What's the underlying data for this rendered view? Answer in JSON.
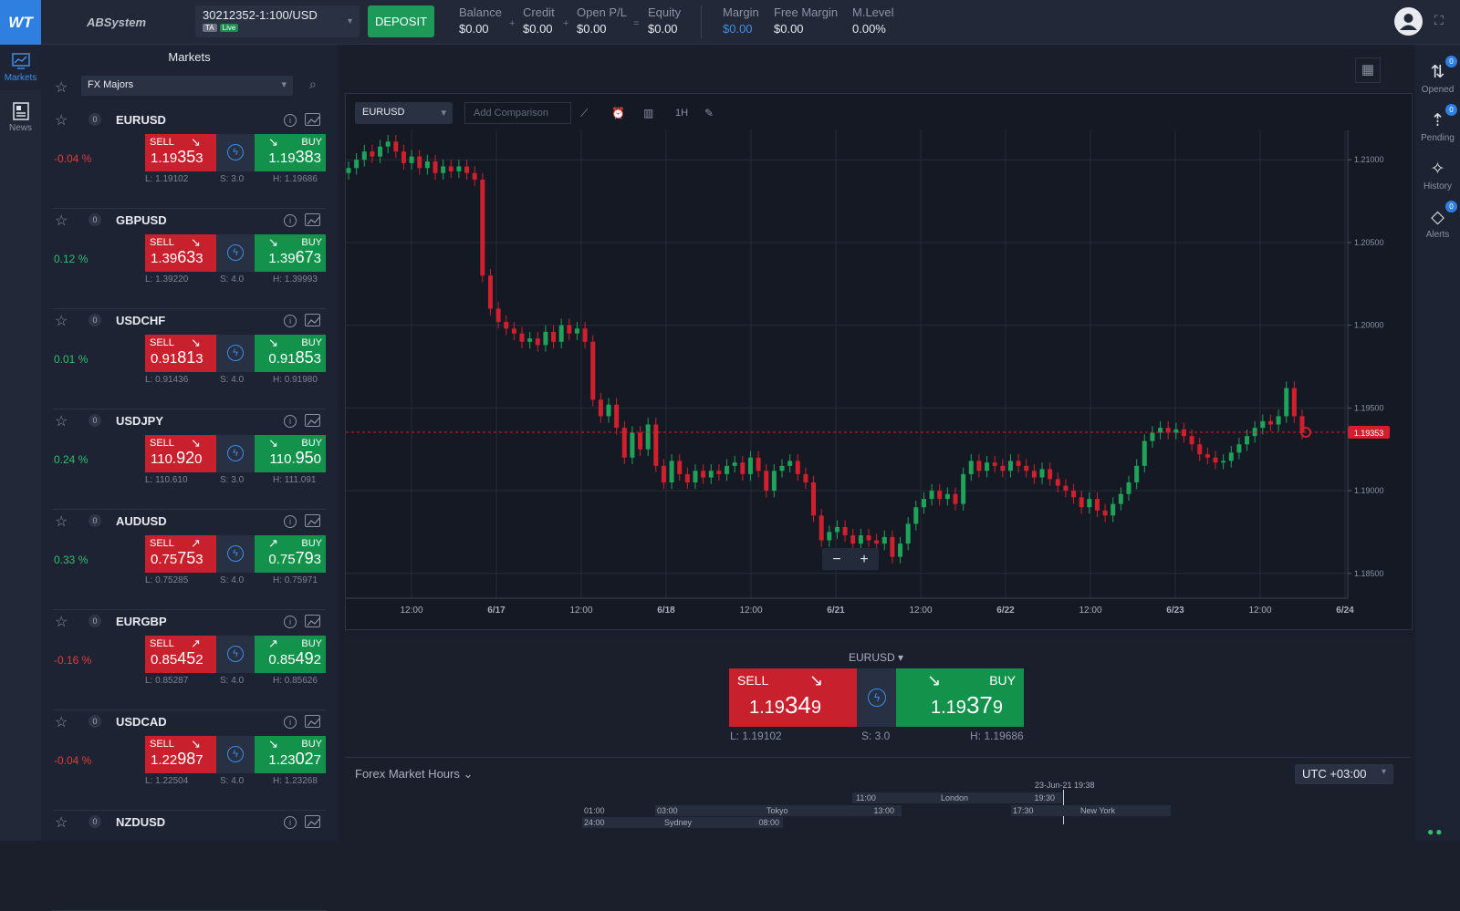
{
  "topbar": {
    "logo": "WT",
    "brand": "ABSystem",
    "account": {
      "number": "30212352-1:100/USD",
      "tag_ta": "TA",
      "tag_live": "Live"
    },
    "deposit_label": "DEPOSIT",
    "stats": [
      {
        "label": "Balance",
        "value": "$0.00"
      },
      {
        "label": "Credit",
        "value": "$0.00"
      },
      {
        "label": "Open P/L",
        "value": "$0.00"
      },
      {
        "label": "Equity",
        "value": "$0.00"
      },
      {
        "label": "Margin",
        "value": "$0.00"
      },
      {
        "label": "Free Margin",
        "value": "$0.00"
      },
      {
        "label": "M.Level",
        "value": "0.00%"
      }
    ],
    "ops": [
      "+",
      "+",
      "="
    ],
    "margin_color": "#3d8fe8"
  },
  "leftnav": {
    "items": [
      {
        "label": "Markets",
        "icon": "chart-monitor-icon"
      },
      {
        "label": "News",
        "icon": "newspaper-icon"
      }
    ]
  },
  "markets": {
    "title": "Markets",
    "filter": "FX Majors",
    "symbols": [
      {
        "name": "EURUSD",
        "count": "0",
        "change": "-0.04 %",
        "dir": "neg",
        "sell": {
          "big": "1.19",
          "pip": "35",
          "small": "3"
        },
        "buy": {
          "big": "1.19",
          "pip": "38",
          "small": "3"
        },
        "low": "L: 1.19102",
        "spread": "S: 3.0",
        "high": "H: 1.19686",
        "arrow": "↘"
      },
      {
        "name": "GBPUSD",
        "count": "0",
        "change": "0.12 %",
        "dir": "pos",
        "sell": {
          "big": "1.39",
          "pip": "63",
          "small": "3"
        },
        "buy": {
          "big": "1.39",
          "pip": "67",
          "small": "3"
        },
        "low": "L: 1.39220",
        "spread": "S: 4.0",
        "high": "H: 1.39993",
        "arrow": "↘"
      },
      {
        "name": "USDCHF",
        "count": "0",
        "change": "0.01 %",
        "dir": "pos",
        "sell": {
          "big": "0.91",
          "pip": "81",
          "small": "3"
        },
        "buy": {
          "big": "0.91",
          "pip": "85",
          "small": "3"
        },
        "low": "L: 0.91436",
        "spread": "S: 4.0",
        "high": "H: 0.91980",
        "arrow": "↘"
      },
      {
        "name": "USDJPY",
        "count": "0",
        "change": "0.24 %",
        "dir": "pos",
        "sell": {
          "big": "110.",
          "pip": "92",
          "small": "0"
        },
        "buy": {
          "big": "110.",
          "pip": "95",
          "small": "0"
        },
        "low": "L: 110.610",
        "spread": "S: 3.0",
        "high": "H: 111.091",
        "arrow": "↘"
      },
      {
        "name": "AUDUSD",
        "count": "0",
        "change": "0.33 %",
        "dir": "pos",
        "sell": {
          "big": "0.75",
          "pip": "75",
          "small": "3"
        },
        "buy": {
          "big": "0.75",
          "pip": "79",
          "small": "3"
        },
        "low": "L: 0.75285",
        "spread": "S: 4.0",
        "high": "H: 0.75971",
        "arrow": "↗"
      },
      {
        "name": "EURGBP",
        "count": "0",
        "change": "-0.16 %",
        "dir": "neg",
        "sell": {
          "big": "0.85",
          "pip": "45",
          "small": "2"
        },
        "buy": {
          "big": "0.85",
          "pip": "49",
          "small": "2"
        },
        "low": "L: 0.85287",
        "spread": "S: 4.0",
        "high": "H: 0.85626",
        "arrow": "↗"
      },
      {
        "name": "USDCAD",
        "count": "0",
        "change": "-0.04 %",
        "dir": "neg",
        "sell": {
          "big": "1.22",
          "pip": "98",
          "small": "7"
        },
        "buy": {
          "big": "1.23",
          "pip": "02",
          "small": "7"
        },
        "low": "L: 1.22504",
        "spread": "S: 4.0",
        "high": "H: 1.23268",
        "arrow": "↘"
      },
      {
        "name": "NZDUSD",
        "count": "0"
      }
    ],
    "sell_label": "SELL",
    "buy_label": "BUY"
  },
  "chart": {
    "symbol": "EURUSD",
    "comparison_placeholder": "Add Comparison",
    "timeframe": "1H",
    "x_labels": [
      "12:00",
      "6/17",
      "12:00",
      "6/18",
      "12:00",
      "6/21",
      "12:00",
      "6/22",
      "12:00",
      "6/23",
      "12:00",
      "6/24"
    ],
    "y_labels": [
      "1.21000",
      "1.20500",
      "1.20000",
      "1.19500",
      "1.19000",
      "1.18500"
    ],
    "current_price": "1.19353"
  },
  "chart_data": {
    "type": "candlestick",
    "y_ticks": [
      1.185,
      1.19,
      1.195,
      1.2,
      1.205,
      1.21
    ],
    "x_ticks": [
      "12:00",
      "6/17",
      "12:00",
      "6/18",
      "12:00",
      "6/21",
      "12:00",
      "6/22",
      "12:00",
      "6/23",
      "12:00",
      "6/24"
    ],
    "current_price": 1.19353,
    "ylim": [
      1.1835,
      1.2115
    ],
    "candles_close": [
      1.2095,
      1.21,
      1.2105,
      1.2102,
      1.2108,
      1.2111,
      1.2105,
      1.2098,
      1.2102,
      1.2095,
      1.2099,
      1.2092,
      1.2096,
      1.2093,
      1.2096,
      1.2092,
      1.2088,
      1.203,
      1.201,
      1.2002,
      1.1998,
      1.1995,
      1.199,
      1.1992,
      1.1988,
      1.1996,
      1.199,
      1.2,
      1.1995,
      1.1998,
      1.199,
      1.1955,
      1.1945,
      1.1952,
      1.1938,
      1.192,
      1.1935,
      1.1925,
      1.194,
      1.1915,
      1.1905,
      1.1918,
      1.191,
      1.1905,
      1.1912,
      1.1908,
      1.1912,
      1.191,
      1.1915,
      1.1917,
      1.191,
      1.192,
      1.1912,
      1.19,
      1.1912,
      1.1915,
      1.1918,
      1.191,
      1.1905,
      1.1885,
      1.187,
      1.1875,
      1.1878,
      1.1873,
      1.1868,
      1.1873,
      1.187,
      1.1868,
      1.1872,
      1.186,
      1.1868,
      1.188,
      1.189,
      1.1895,
      1.19,
      1.1895,
      1.1898,
      1.1892,
      1.191,
      1.1918,
      1.1912,
      1.1917,
      1.1915,
      1.1912,
      1.1918,
      1.1915,
      1.1912,
      1.1908,
      1.1913,
      1.1907,
      1.1903,
      1.19,
      1.1896,
      1.189,
      1.1895,
      1.1888,
      1.1885,
      1.1892,
      1.1898,
      1.1905,
      1.1915,
      1.193,
      1.1935,
      1.1938,
      1.1935,
      1.1937,
      1.1933,
      1.1928,
      1.1922,
      1.192,
      1.1917,
      1.1918,
      1.1923,
      1.1928,
      1.1933,
      1.1938,
      1.1942,
      1.194,
      1.1945,
      1.1962,
      1.1945,
      1.1935
    ]
  },
  "trade": {
    "symbol": "EURUSD",
    "sell_label": "SELL",
    "buy_label": "BUY",
    "sell_big": "1.19",
    "sell_pip": "34",
    "sell_small": "9",
    "buy_big": "1.19",
    "buy_pip": "37",
    "buy_small": "9",
    "low": "L: 1.19102",
    "spread": "S: 3.0",
    "high": "H: 1.19686"
  },
  "market_hours": {
    "title": "Forex Market Hours",
    "timezone": "UTC +03:00",
    "now": "23-Jun-21 19:38",
    "sessions": [
      {
        "name": "London",
        "open": "11:00",
        "close": "19:30"
      },
      {
        "name": "Tokyo",
        "open": "03:00",
        "close": "13:00"
      },
      {
        "name": "New York",
        "open": "17:30",
        "close": ""
      },
      {
        "name": "Sydney",
        "open": "24:00",
        "close": "08:00"
      }
    ],
    "extra_time": "01:00"
  },
  "rightnav": {
    "items": [
      {
        "label": "Opened",
        "badge": "0"
      },
      {
        "label": "Pending",
        "badge": "0"
      },
      {
        "label": "History",
        "badge": ""
      },
      {
        "label": "Alerts",
        "badge": "0"
      }
    ]
  }
}
